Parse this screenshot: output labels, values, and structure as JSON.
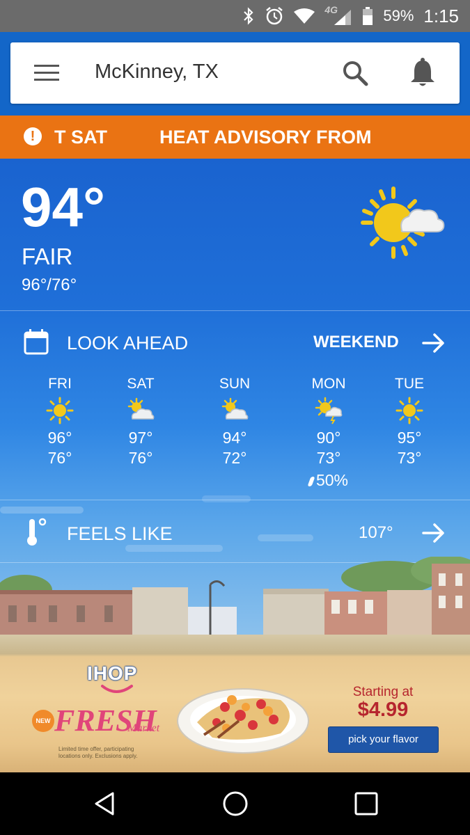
{
  "status_bar": {
    "network": "4G",
    "battery": "59%",
    "time": "1:15"
  },
  "header": {
    "location": "McKinney, TX"
  },
  "alert": {
    "text": "T SAT          HEAT ADVISORY FROM"
  },
  "current": {
    "temp": "94°",
    "condition": "FAIR",
    "hilo": "96°/76°",
    "icon": "partly-sunny-icon"
  },
  "look_ahead": {
    "label": "LOOK AHEAD",
    "link": "WEEKEND",
    "days": [
      {
        "name": "FRI",
        "hi": "96°",
        "lo": "76°",
        "icon": "sunny-icon",
        "precip": ""
      },
      {
        "name": "SAT",
        "hi": "97°",
        "lo": "76°",
        "icon": "mostly-sunny-icon",
        "precip": ""
      },
      {
        "name": "SUN",
        "hi": "94°",
        "lo": "72°",
        "icon": "mostly-sunny-icon",
        "precip": ""
      },
      {
        "name": "MON",
        "hi": "90°",
        "lo": "73°",
        "icon": "sun-cloud-storm-icon",
        "precip": "50%"
      },
      {
        "name": "TUE",
        "hi": "95°",
        "lo": "73°",
        "icon": "sunny-icon",
        "precip": ""
      }
    ]
  },
  "feels_like": {
    "label": "FEELS LIKE",
    "value": "107°"
  },
  "ad": {
    "brand": "IHOP",
    "badge": "NEW",
    "headline": "FRESH",
    "sub": "Market",
    "fineprint": "Limited time offer, participating locations only. Exclusions apply.",
    "starting": "Starting at",
    "price": "$4.99",
    "cta": "pick your flavor"
  },
  "colors": {
    "alert": "#ea7313",
    "appbar": "#1366c8",
    "ad_button": "#1f56a8",
    "price": "#b6262e"
  }
}
